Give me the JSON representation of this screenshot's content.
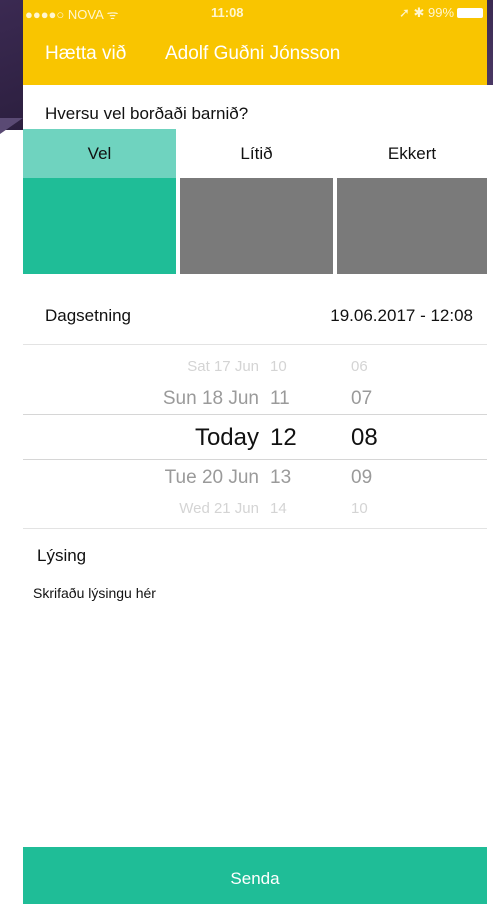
{
  "status_bar": {
    "carrier": "●●●●○ NOVA ᯤ",
    "time": "11:08",
    "right": "➚ ✱ 99%"
  },
  "header": {
    "cancel_label": "Hætta við",
    "title": "Adolf Guðni Jónsson"
  },
  "question": "Hversu vel borðaði barnið?",
  "options": [
    {
      "label": "Vel",
      "selected": true,
      "color": "#1fbd97"
    },
    {
      "label": "Lítið",
      "selected": false,
      "color": "#7a7a7a"
    },
    {
      "label": "Ekkert",
      "selected": false,
      "color": "#7a7a7a"
    }
  ],
  "date": {
    "label": "Dagsetning",
    "value": "19.06.2017 - 12:08"
  },
  "picker": {
    "rows": [
      {
        "day": "Sat 17 Jun",
        "hour": "10",
        "minute": "06"
      },
      {
        "day": "Sun 18 Jun",
        "hour": "11",
        "minute": "07"
      },
      {
        "day": "Today",
        "hour": "12",
        "minute": "08"
      },
      {
        "day": "Tue 20 Jun",
        "hour": "13",
        "minute": "09"
      },
      {
        "day": "Wed 21 Jun",
        "hour": "14",
        "minute": "10"
      }
    ]
  },
  "description": {
    "label": "Lýsing",
    "placeholder": "Skrifaðu lýsingu hér"
  },
  "submit_label": "Senda",
  "colors": {
    "header": "#f9c500",
    "accent": "#1fbd97",
    "selected_tab": "#6fd3bf",
    "unselected": "#7a7a7a"
  }
}
